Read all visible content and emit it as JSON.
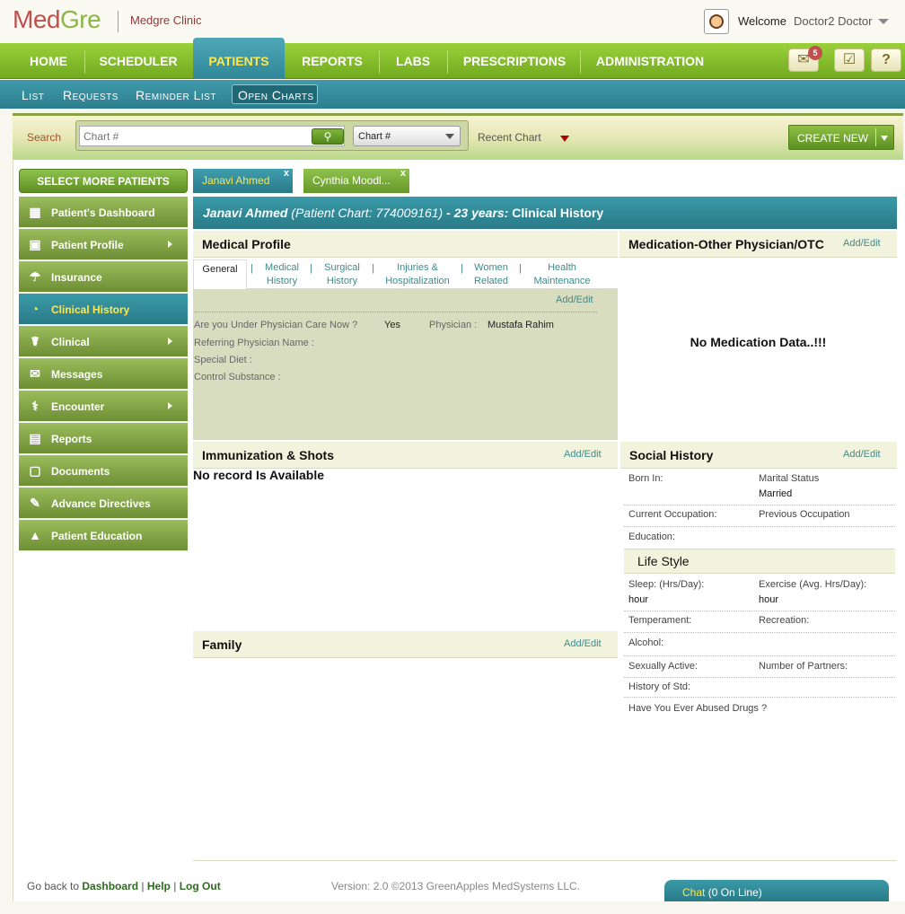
{
  "header": {
    "logo_med": "Med",
    "logo_gre": "Gre",
    "clinic": "Medgre Clinic",
    "welcome": "Welcome",
    "user": "Doctor2 Doctor"
  },
  "nav": {
    "items": [
      "HOME",
      "SCHEDULER",
      "PATIENTS",
      "REPORTS",
      "LABS",
      "PRESCRIPTIONS",
      "ADMINISTRATION"
    ],
    "active": "PATIENTS",
    "mail_badge": "5",
    "help_label": "?"
  },
  "subnav": {
    "items": [
      "List",
      "Requests",
      "Reminder List",
      "Open Charts"
    ]
  },
  "search": {
    "label": "Search",
    "placeholder": "Chart #",
    "select_value": "Chart #",
    "recent": "Recent Chart",
    "create_new": "CREATE NEW"
  },
  "sidebar": {
    "more_button": "SELECT MORE PATIENTS",
    "items": [
      {
        "label": "Patient's Dashboard",
        "icon": "dashboard-icon"
      },
      {
        "label": "Patient Profile",
        "icon": "profile-icon"
      },
      {
        "label": "Insurance",
        "icon": "insurance-icon"
      },
      {
        "label": "Clinical History",
        "icon": "history-icon"
      },
      {
        "label": "Clinical",
        "icon": "caduceus-icon"
      },
      {
        "label": "Messages",
        "icon": "envelope-icon"
      },
      {
        "label": "Encounter",
        "icon": "stethoscope-icon"
      },
      {
        "label": "Reports",
        "icon": "report-icon"
      },
      {
        "label": "Documents",
        "icon": "document-icon"
      },
      {
        "label": "Advance Directives",
        "icon": "directive-icon"
      },
      {
        "label": "Patient Education",
        "icon": "graduation-icon"
      }
    ],
    "active": "Clinical History"
  },
  "patient_tabs": [
    {
      "name": "Janavi Ahmed",
      "close": "x"
    },
    {
      "name": "Cynthia Moodl...",
      "close": "x"
    }
  ],
  "patient_header": {
    "name": "Janavi Ahmed",
    "chart": "(Patient Chart: 774009161)",
    "age": "- 23 years:",
    "section": "Clinical History"
  },
  "medical_profile": {
    "title": "Medical Profile",
    "tabs": [
      {
        "l1": "General",
        "l2": ""
      },
      {
        "l1": "Medical",
        "l2": "History"
      },
      {
        "l1": "Surgical",
        "l2": "History"
      },
      {
        "l1": "Injuries &",
        "l2": "Hospitalization"
      },
      {
        "l1": "Women",
        "l2": "Related"
      },
      {
        "l1": "Health",
        "l2": "Maintenance"
      }
    ],
    "add_edit": "Add/Edit",
    "under_care_label": "Are you Under Physician Care Now ?",
    "under_care_value": "Yes",
    "physician_label": "Physician :",
    "physician_value": "Mustafa Rahim",
    "referring_label": "Referring Physician Name :",
    "diet_label": "Special Diet :",
    "substance_label": "Control Substance :"
  },
  "medication": {
    "title": "Medication-Other Physician/OTC",
    "add_edit": "Add/Edit",
    "empty": "No Medication Data..!!!"
  },
  "immunization": {
    "title": "Immunization & Shots",
    "add_edit": "Add/Edit",
    "empty": "No record Is Available"
  },
  "family": {
    "title": "Family",
    "add_edit": "Add/Edit"
  },
  "social_history": {
    "title": "Social History",
    "add_edit": "Add/Edit",
    "born_in": "Born In:",
    "marital_label": "Marital Status",
    "marital_value": "Married",
    "current_occ": "Current Occupation:",
    "previous_occ": "Previous Occupation",
    "education": "Education:",
    "lifestyle_title": "Life Style",
    "sleep_label": "Sleep: (Hrs/Day):",
    "sleep_value": "hour",
    "exercise_label": "Exercise (Avg. Hrs/Day):",
    "exercise_value": "hour",
    "temperament": "Temperament:",
    "recreation": "Recreation:",
    "alcohol": "Alcohol:",
    "sexually_active": "Sexually Active:",
    "partners": "Number of Partners:",
    "std": "History of Std:",
    "drugs": "Have You Ever Abused Drugs ?"
  },
  "footer": {
    "go_back": "Go back to",
    "dashboard": "Dashboard",
    "sep1": "|",
    "help": "Help",
    "sep2": "|",
    "logout": "Log Out",
    "version": "Version: 2.0 ©2013 GreenApples MedSystems LLC.",
    "chat_label": "Chat",
    "chat_status": "(0 On Line)"
  }
}
